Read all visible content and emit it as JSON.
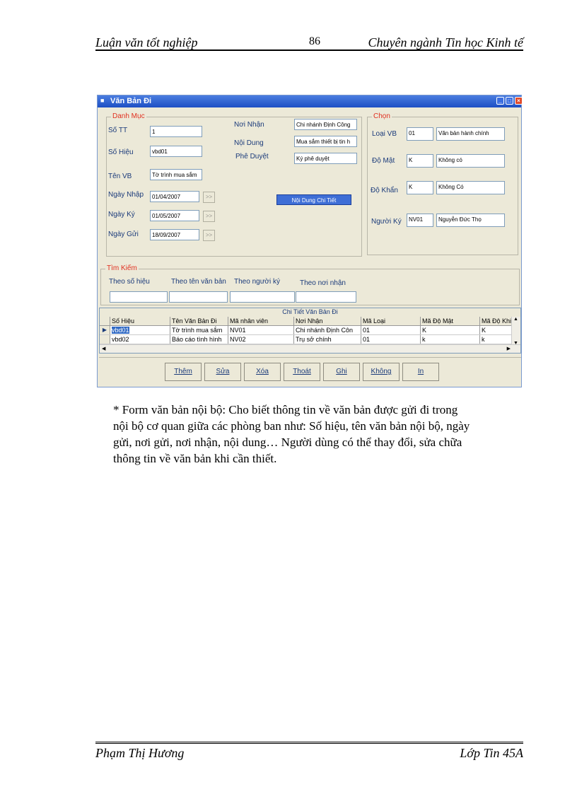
{
  "header": {
    "left": "Luận văn tốt nghiệp",
    "page": "86",
    "right": "Chuyên ngành Tin học Kinh tế"
  },
  "window": {
    "title": "Văn Bản Đi",
    "danh_muc": {
      "legend": "Danh Mục",
      "fields": [
        {
          "label": "Số TT",
          "value": "1"
        },
        {
          "label": "Số Hiệu",
          "value": "vbd01"
        },
        {
          "label": "Tên VB",
          "value": "Tờ trình mua sắm"
        },
        {
          "label": "Ngày Nhập",
          "value": "01/04/2007"
        },
        {
          "label": "Ngày Ký",
          "value": "01/05/2007"
        },
        {
          "label": "Ngày Gửi",
          "value": "18/09/2007"
        }
      ],
      "right_fields": [
        {
          "label": "Nơi Nhận",
          "value": "Chi nhánh Định Công"
        },
        {
          "label": "Nội Dung",
          "value": "Mua sắm thiết bị tin h"
        },
        {
          "label": "Phê Duyệt",
          "value": "Ký phê duyệt"
        }
      ],
      "picker_label": ">>",
      "detail_button": "Nội Dung Chi Tiết"
    },
    "chon": {
      "legend": "Chọn",
      "rows": [
        {
          "label": "Loại VB",
          "code": "01",
          "name": "Văn bản hành chính"
        },
        {
          "label": "Độ Mật",
          "code": "K",
          "name": "Không có"
        },
        {
          "label": "Độ Khẩn",
          "code": "K",
          "name": "Không Có"
        },
        {
          "label": "Người Ký",
          "code": "NV01",
          "name": "Nguyễn Đức Thọ"
        }
      ]
    },
    "tim_kiem": {
      "legend": "Tìm Kiếm",
      "fields": [
        {
          "label": "Theo số hiệu",
          "value": ""
        },
        {
          "label": "Theo tên văn bản",
          "value": ""
        },
        {
          "label": "Theo người ký",
          "value": ""
        },
        {
          "label": "Theo nơi nhận",
          "value": ""
        }
      ]
    },
    "grid": {
      "caption": "Chi Tiết Văn Bản Đi",
      "columns": [
        "Số Hiệu",
        "Tên Văn Bản Đi",
        "Mã nhân viên",
        "Nơi Nhận",
        "Mã Loại",
        "Mã Độ Mật",
        "Mã Độ Khi"
      ],
      "rows": [
        [
          "vbd01",
          "Tờ trình mua sắm",
          "NV01",
          "Chi nhánh Định Côn",
          "01",
          "K",
          "K"
        ],
        [
          "vbd02",
          "Báo cáo tình hình",
          "NV02",
          "Trụ sở chính",
          "01",
          "k",
          "k"
        ]
      ]
    },
    "buttons": [
      "Thêm",
      "Sửa",
      "Xóa",
      "Thoát",
      "Ghi",
      "Không",
      "In"
    ]
  },
  "caption": [
    "* Form văn bản nội bộ: Cho biết thông tin về văn bản được gửi đi trong",
    "nội bộ cơ quan giữa các phòng ban như: Số hiệu, tên văn bản nội bộ, ngày",
    "gửi, nơi gửi, nơi nhận, nội dung… Người dùng có thể thay đổi, sửa chữa",
    "thông tin về văn bản khi cần thiết."
  ],
  "footer": {
    "left": "Phạm Thị Hương",
    "right": "Lớp Tin 45A"
  }
}
